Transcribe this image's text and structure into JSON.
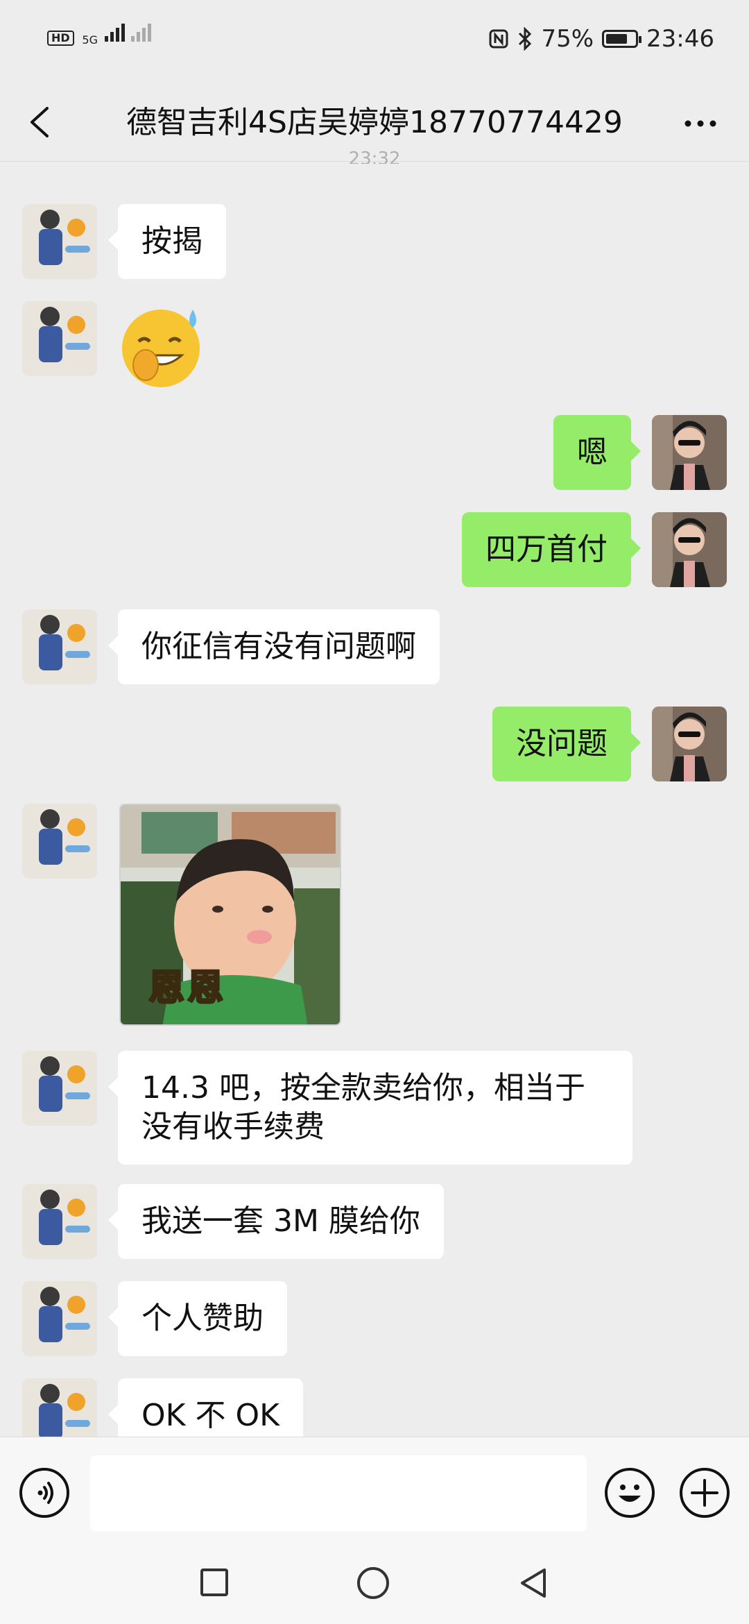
{
  "status_bar": {
    "left_hd": "HD",
    "left_net": "5G",
    "battery_percent": 75,
    "battery_label": "75%",
    "time": "23:46"
  },
  "header": {
    "title": "德智吉利4S店吴婷婷18770774429",
    "back_icon": "chevron-left-icon",
    "more_icon": "more-dots-icon"
  },
  "chat": {
    "timestamp_partial": "23:32",
    "messages": [
      {
        "side": "left",
        "type": "text",
        "text": "按揭"
      },
      {
        "side": "left",
        "type": "emoji",
        "emoji": "sweat-grin-emoji"
      },
      {
        "side": "right",
        "type": "text",
        "text": "嗯"
      },
      {
        "side": "right",
        "type": "text",
        "text": "四万首付"
      },
      {
        "side": "left",
        "type": "text",
        "text": "你征信有没有问题啊"
      },
      {
        "side": "right",
        "type": "text",
        "text": "没问题"
      },
      {
        "side": "left",
        "type": "sticker",
        "caption": "恩恩"
      },
      {
        "side": "left",
        "type": "text",
        "text": "14.3 吧，按全款卖给你，相当于没有收手续费"
      },
      {
        "side": "left",
        "type": "text",
        "text": "我送一套 3M 膜给你"
      },
      {
        "side": "left",
        "type": "text",
        "text": "个人赞助"
      },
      {
        "side": "left",
        "type": "text",
        "text": "OK 不 OK"
      }
    ]
  },
  "input_bar": {
    "voice_icon": "voice-icon",
    "emoji_icon": "smile-icon",
    "plus_icon": "plus-icon",
    "text_value": ""
  },
  "nav_bar": {
    "recent_icon": "square-icon",
    "home_icon": "circle-icon",
    "back_icon": "triangle-back-icon"
  },
  "colors": {
    "background": "#ededed",
    "incoming_bubble": "#ffffff",
    "outgoing_bubble": "#95ec69"
  }
}
